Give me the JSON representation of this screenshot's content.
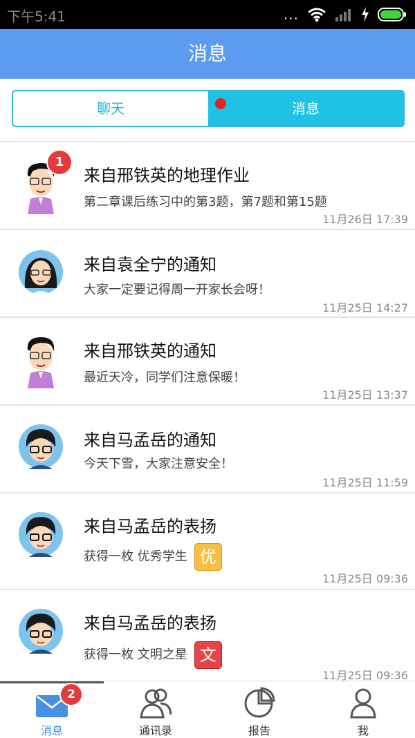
{
  "status": {
    "time": "下午5:41",
    "dots": "..."
  },
  "header": {
    "title": "消息"
  },
  "tabs": {
    "left": "聊天",
    "right": "消息"
  },
  "items": [
    {
      "title": "来自邢铁英的地理作业",
      "subtitle": "第二章课后练习中的第3题，第7题和第15题",
      "time": "11月26日 17:39",
      "badge": "1",
      "avatar": "teacher-male-icon"
    },
    {
      "title": "来自袁全宁的通知",
      "subtitle": "大家一定要记得周一开家长会呀！",
      "time": "11月25日 14:27",
      "avatar": "teacher-female-icon"
    },
    {
      "title": "来自邢铁英的通知",
      "subtitle": "最近天冷，同学们注意保暖！",
      "time": "11月25日 13:37",
      "avatar": "teacher-male-icon"
    },
    {
      "title": "来自马孟岳的通知",
      "subtitle": "今天下雪，大家注意安全！",
      "time": "11月25日 11:59",
      "avatar": "student-boy-icon"
    },
    {
      "title": "来自马孟岳的表扬",
      "subtitle": "获得一枚 优秀学生",
      "tag": "优",
      "time": "11月25日 09:36",
      "avatar": "student-boy-icon"
    },
    {
      "title": "来自马孟岳的表扬",
      "subtitle": "获得一枚 文明之星",
      "tag": "文",
      "time": "11月25日 09:36",
      "avatar": "student-boy-icon"
    }
  ],
  "nav": {
    "items": [
      {
        "label": "消息",
        "icon": "mail-icon",
        "badge": "2"
      },
      {
        "label": "通讯录",
        "icon": "contacts-icon"
      },
      {
        "label": "报告",
        "icon": "report-icon"
      },
      {
        "label": "我",
        "icon": "profile-icon"
      }
    ]
  },
  "colors": {
    "header": "#5b9cf0",
    "accent": "#1fc1e6",
    "badge": "#e53a3a"
  }
}
